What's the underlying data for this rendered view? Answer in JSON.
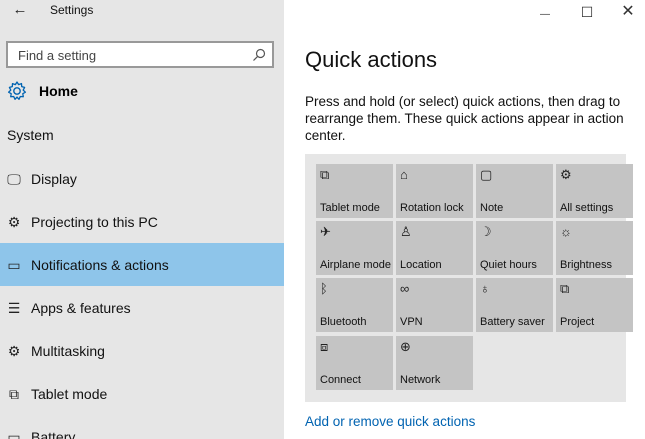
{
  "window": {
    "title": "Settings",
    "back_icon": "←",
    "minimize_icon": "—",
    "maximize_icon": "☐",
    "close_icon": "✕"
  },
  "sidebar": {
    "search_placeholder": "Find a setting",
    "home_label": "Home",
    "section_label": "System",
    "items": [
      {
        "label": "Display",
        "icon": "display-icon",
        "glyph": "🖵"
      },
      {
        "label": "Projecting to this PC",
        "icon": "projecting-icon",
        "glyph": "⚙"
      },
      {
        "label": "Notifications & actions",
        "icon": "notifications-icon",
        "glyph": "▭",
        "selected": true
      },
      {
        "label": "Apps & features",
        "icon": "apps-icon",
        "glyph": "☰"
      },
      {
        "label": "Multitasking",
        "icon": "multitasking-icon",
        "glyph": "⚙"
      },
      {
        "label": "Tablet mode",
        "icon": "tablet-mode-icon",
        "glyph": "⧉"
      },
      {
        "label": "Battery",
        "icon": "battery-icon",
        "glyph": "▭"
      }
    ]
  },
  "main": {
    "title": "Quick actions",
    "description": "Press and hold (or select) quick actions, then drag to rearrange them. These quick actions appear in action center.",
    "tiles": [
      {
        "label": "Tablet mode",
        "icon": "tablet-mode-icon",
        "glyph": "⧉"
      },
      {
        "label": "Rotation lock",
        "icon": "rotation-lock-icon",
        "glyph": "⌂"
      },
      {
        "label": "Note",
        "icon": "note-icon",
        "glyph": "▢"
      },
      {
        "label": "All settings",
        "icon": "settings-gear-icon",
        "glyph": "⚙"
      },
      {
        "label": "Airplane mode",
        "icon": "airplane-icon",
        "glyph": "✈"
      },
      {
        "label": "Location",
        "icon": "location-icon",
        "glyph": "♙"
      },
      {
        "label": "Quiet hours",
        "icon": "moon-icon",
        "glyph": "☽"
      },
      {
        "label": "Brightness",
        "icon": "brightness-icon",
        "glyph": "☼"
      },
      {
        "label": "Bluetooth",
        "icon": "bluetooth-icon",
        "glyph": "ᛒ"
      },
      {
        "label": "VPN",
        "icon": "vpn-icon",
        "glyph": "∞"
      },
      {
        "label": "Battery saver",
        "icon": "battery-saver-icon",
        "glyph": "♁"
      },
      {
        "label": "Project",
        "icon": "project-icon",
        "glyph": "⧉"
      },
      {
        "label": "Connect",
        "icon": "connect-icon",
        "glyph": "⧈"
      },
      {
        "label": "Network",
        "icon": "network-globe-icon",
        "glyph": "⊕"
      }
    ],
    "add_remove_link": "Add or remove quick actions"
  },
  "colors": {
    "sidebar_bg": "#e6e6e6",
    "selected_bg": "#8ec5ea",
    "accent": "#0063b1",
    "tile_bg": "#c4c4c4"
  }
}
